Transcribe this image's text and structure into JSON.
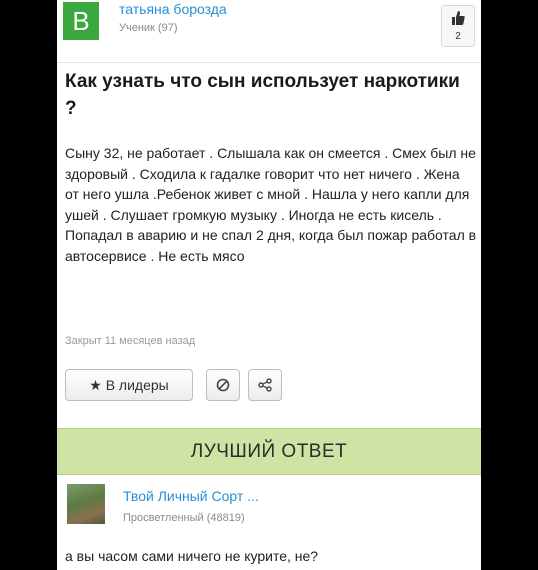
{
  "header": {
    "avatar_letter": "В",
    "user_name": "татьяна борозда",
    "user_rank": "Ученик (97)",
    "like_count": "2"
  },
  "question": {
    "title": "Как узнать что сын использует наркотики ?",
    "body": "Сыну 32, не работает . Слышала как он смеется . Смех был не здоровый . Сходила к гадалке говорит что нет ничего . Жена от него ушла .Ребенок живет с мной . Нашла у него капли для ушей . Слушает громкую музыку . Иногда не есть кисель . Попадал в аварию и не спал 2 дня, когда был пожар работал в автосервисе . Не есть мясо",
    "time": "Закрыт 11 месяцев назад"
  },
  "actions": {
    "leaders_label": "★ В лидеры"
  },
  "best_answer": {
    "bar_label": "ЛУЧШИЙ ОТВЕТ",
    "user_name": "Твой Личный Сорт ...",
    "user_rank": "Просветленный (48819)",
    "text": "а вы часом сами ничего не курите, не?"
  },
  "colors": {
    "avatar": "#3aa83c",
    "link": "#2a8fd6",
    "best_bar": "#cfe3a4"
  }
}
